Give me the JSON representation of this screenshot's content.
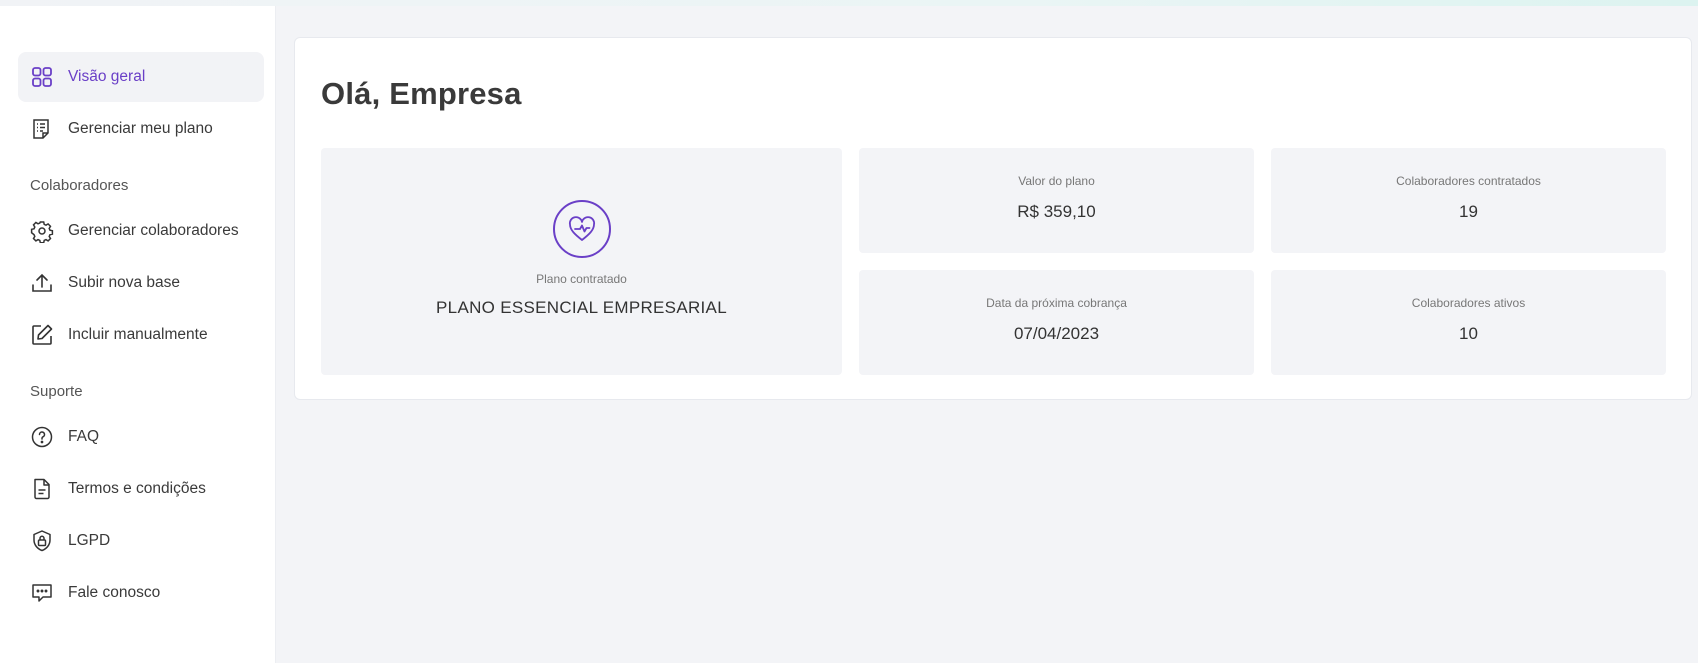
{
  "sidebar": {
    "items_main": [
      {
        "label": "Visão geral",
        "icon": "grid-icon",
        "active": true
      },
      {
        "label": "Gerenciar meu plano",
        "icon": "list-document-icon",
        "active": false
      }
    ],
    "section_colaboradores": "Colaboradores",
    "items_colaboradores": [
      {
        "label": "Gerenciar colaboradores",
        "icon": "gear-icon"
      },
      {
        "label": "Subir nova base",
        "icon": "upload-icon"
      },
      {
        "label": "Incluir manualmente",
        "icon": "edit-icon"
      }
    ],
    "section_suporte": "Suporte",
    "items_suporte": [
      {
        "label": "FAQ",
        "icon": "question-icon"
      },
      {
        "label": "Termos e condições",
        "icon": "document-icon"
      },
      {
        "label": "LGPD",
        "icon": "shield-lock-icon"
      },
      {
        "label": "Fale conosco",
        "icon": "chat-icon"
      }
    ]
  },
  "main": {
    "greeting": "Olá, Empresa",
    "plan": {
      "label": "Plano contratado",
      "name": "PLANO ESSENCIAL EMPRESARIAL",
      "icon": "heart-pulse-icon"
    },
    "stats": [
      {
        "label": "Valor do plano",
        "value": "R$ 359,10"
      },
      {
        "label": "Colaboradores contratados",
        "value": "19"
      },
      {
        "label": "Data da próxima cobrança",
        "value": "07/04/2023"
      },
      {
        "label": "Colaboradores ativos",
        "value": "10"
      }
    ]
  },
  "colors": {
    "accent": "#6a3fc7",
    "background": "#f3f4f7",
    "tile": "#f3f4f7"
  }
}
